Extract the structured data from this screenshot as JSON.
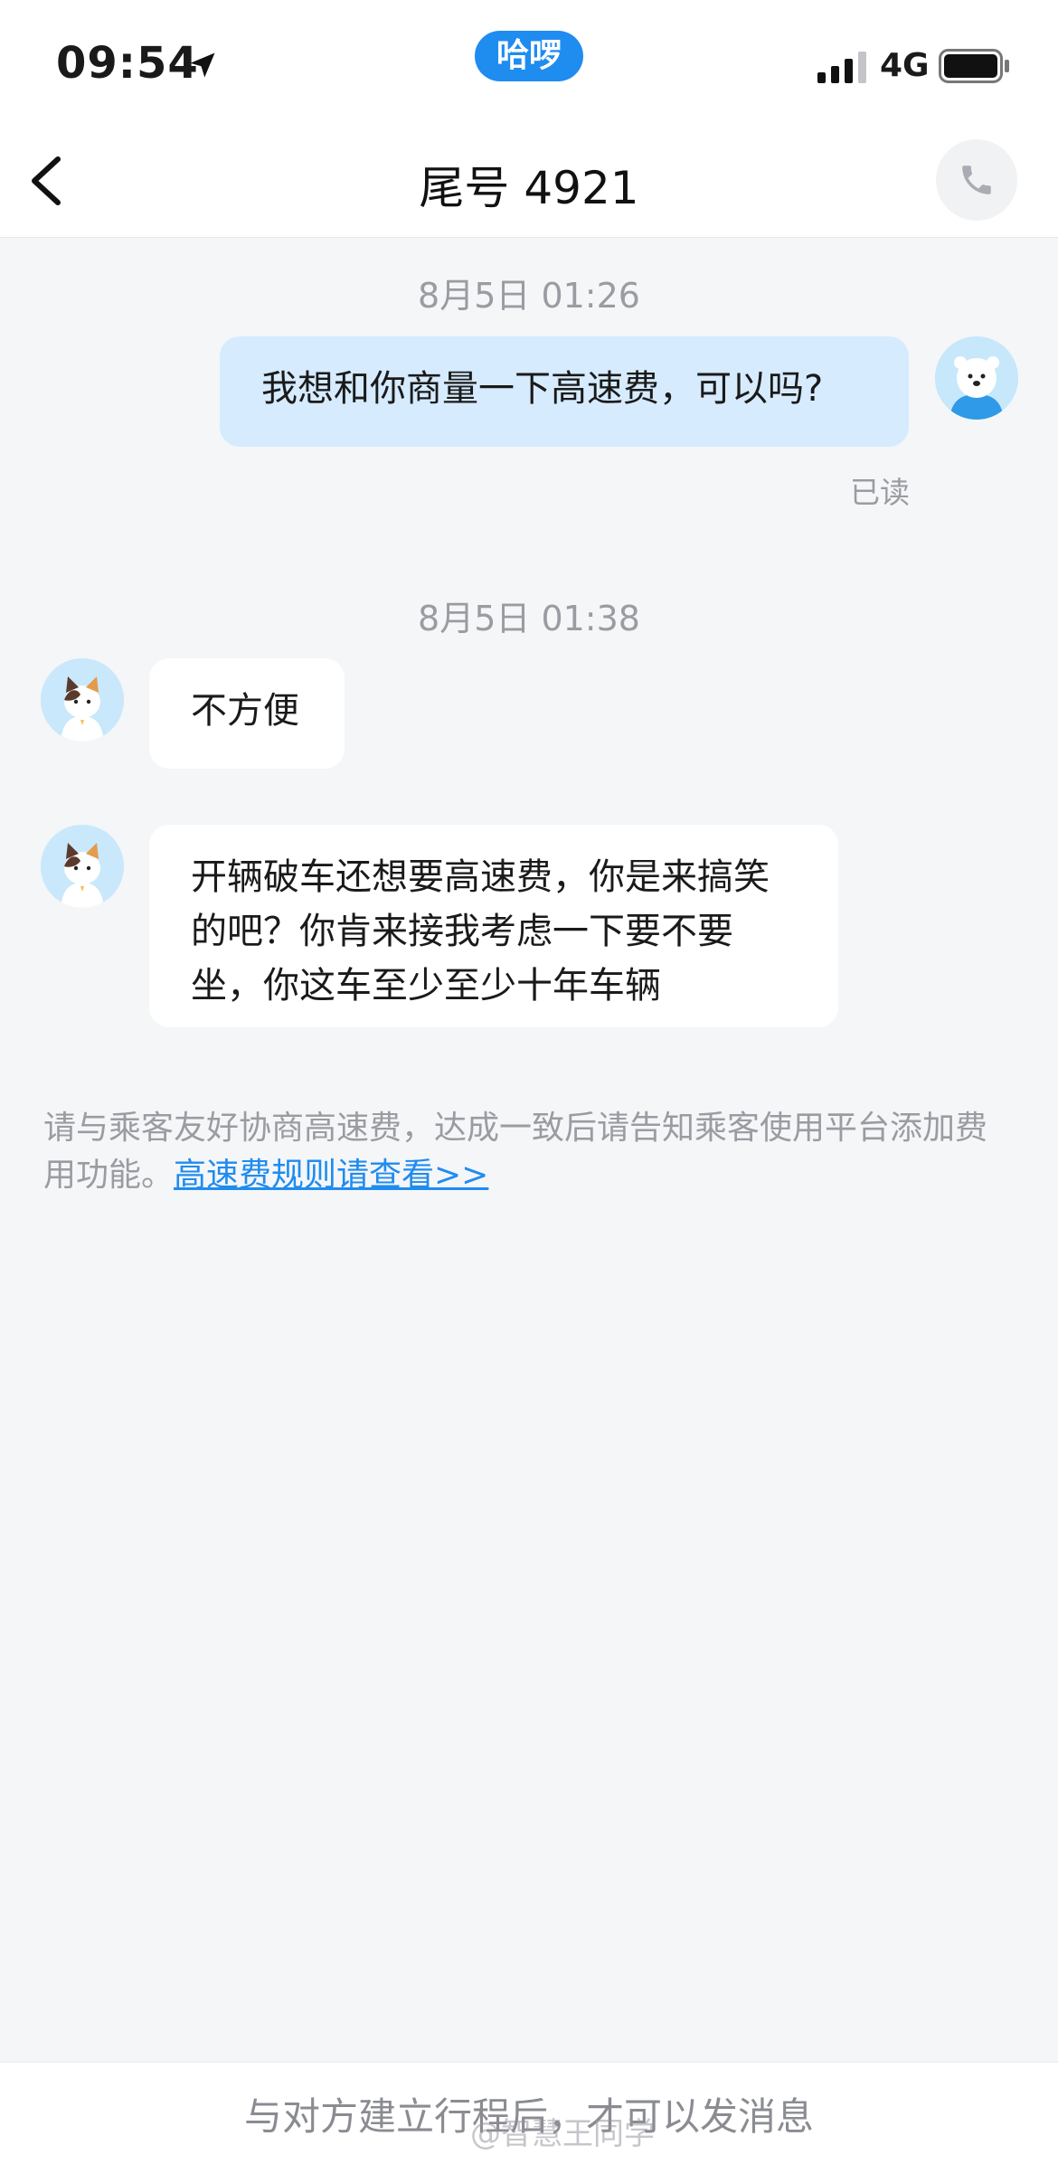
{
  "status_bar": {
    "time": "09:54",
    "app_badge": "哈啰",
    "network": "4G",
    "icons": [
      "location-arrow-icon",
      "signal-icon",
      "battery-icon"
    ]
  },
  "nav": {
    "title": "尾号 4921",
    "icons": [
      "back-chevron-icon",
      "phone-icon"
    ]
  },
  "messages": [
    {
      "timestamp": "8月5日 01:26",
      "direction": "outgoing",
      "text": "我想和你商量一下高速费，可以吗?",
      "status": "已读",
      "avatar": "bear-avatar"
    },
    {
      "timestamp": "8月5日 01:38",
      "direction": "incoming",
      "text": "不方便",
      "avatar": "cat-avatar"
    },
    {
      "direction": "incoming",
      "text": "开辆破车还想要高速费，你是来搞笑的吧？你肯来接我考虑一下要不要坐，你这车至少至少十年车辆",
      "avatar": "cat-avatar"
    }
  ],
  "tip": {
    "text": "请与乘客友好协商高速费，达成一致后请告知乘客使用平台添加费用功能。",
    "link": "高速费规则请查看>>"
  },
  "bottom_bar": {
    "text": "与对方建立行程后，才可以发消息"
  },
  "watermark": "@智慧王同学",
  "colors": {
    "accent": "#1f8cf0",
    "outgoing_bubble": "#d6ebfd",
    "incoming_bubble": "#ffffff",
    "background": "#f5f6f8",
    "muted_text": "#9a9ca2"
  }
}
